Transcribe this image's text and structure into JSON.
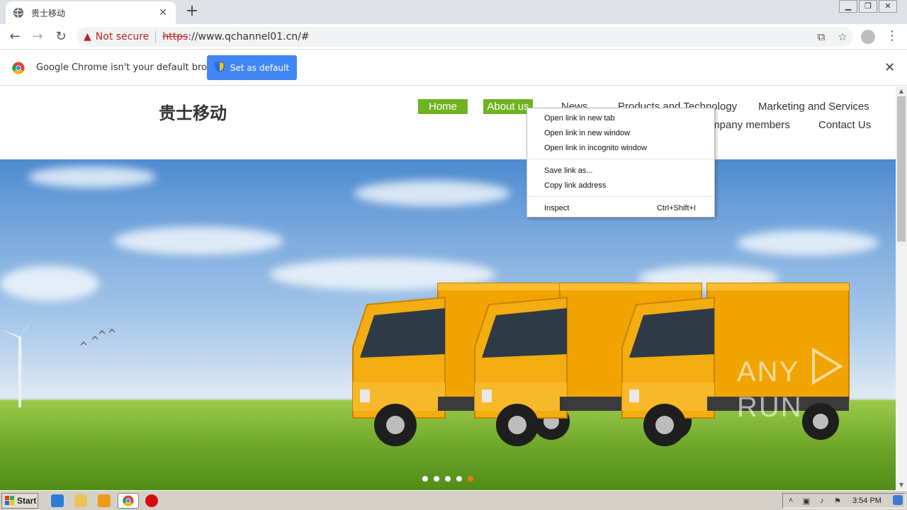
{
  "browser": {
    "tab": {
      "title": "贵士移动"
    },
    "address": {
      "security_label": "Not secure",
      "scheme": "https",
      "url_rest": "://www.qchannel01.cn/#"
    },
    "infobar": {
      "message": "Google Chrome isn't your default browser",
      "button": "Set as default"
    }
  },
  "site": {
    "logo": "贵士移动",
    "nav": [
      {
        "label": "Home"
      },
      {
        "label": "About us"
      },
      {
        "label": "News"
      },
      {
        "label": "Products and Technology"
      },
      {
        "label": "Marketing and Services"
      },
      {
        "label": "Company members"
      },
      {
        "label": "Contact Us"
      }
    ],
    "slider": {
      "count": 5,
      "active_index": 4
    }
  },
  "context_menu": {
    "items": [
      {
        "label": "Open link in new tab",
        "shortcut": ""
      },
      {
        "label": "Open link in new window",
        "shortcut": ""
      },
      {
        "label": "Open link in incognito window",
        "shortcut": ""
      },
      {
        "label": "Save link as...",
        "shortcut": ""
      },
      {
        "label": "Copy link address",
        "shortcut": ""
      },
      {
        "label": "Inspect",
        "shortcut": "Ctrl+Shift+I"
      }
    ]
  },
  "watermark": {
    "left": "ANY",
    "right": "RUN"
  },
  "taskbar": {
    "start_label": "Start",
    "clock": "3:54 PM"
  },
  "colors": {
    "nav_active": "#6fb321",
    "set_default_button": "#4285f4",
    "not_secure": "#c5221f",
    "slider_active": "#f07820"
  }
}
